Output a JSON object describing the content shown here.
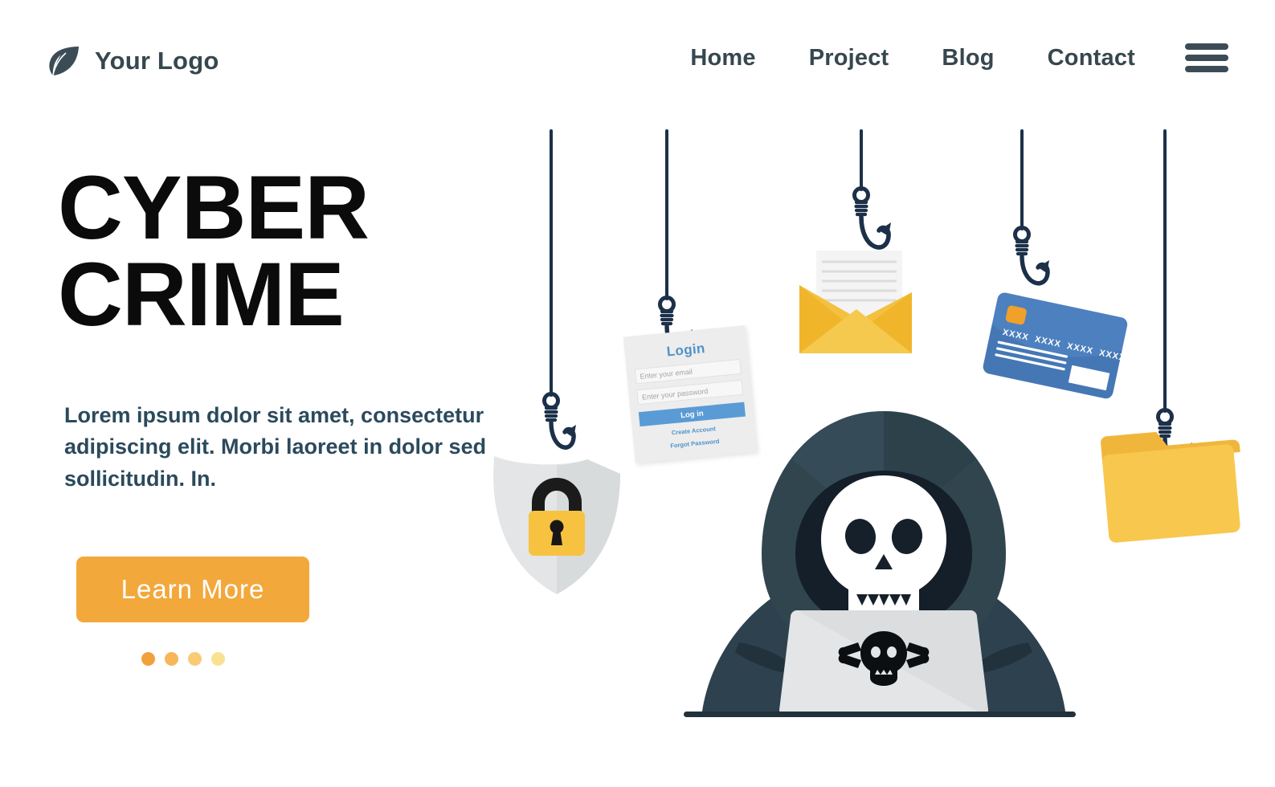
{
  "header": {
    "logo": {
      "text": "Your Logo",
      "icon": "leaf-icon",
      "color": "#36474F"
    },
    "nav_items": [
      {
        "label": "Home"
      },
      {
        "label": "Project"
      },
      {
        "label": "Blog"
      },
      {
        "label": "Contact"
      }
    ],
    "menu_icon": "hamburger-menu-icon"
  },
  "hero": {
    "headline_line1": "CYBER",
    "headline_line2": "CRIME",
    "paragraph": "Lorem ipsum dolor sit amet, consectetur adipiscing elit. Morbi laoreet in dolor sed sollicitudin. In.",
    "cta_label": "Learn  More",
    "carousel_dots": [
      "#F2A03C",
      "#F6B659",
      "#F9CC73",
      "#FAE191"
    ],
    "colors": {
      "headline": "#0B0B0B",
      "paragraph": "#2B4A5C",
      "cta_background": "#F3A83C",
      "cta_text": "#FFFFFF"
    }
  },
  "illustration": {
    "theme": "phishing-hooks-cyber-crime",
    "hook_color": "#1C3049",
    "hooks": [
      {
        "name": "shield-lock-hook",
        "bait": "shield-padlock"
      },
      {
        "name": "login-form-hook",
        "bait": "login-card"
      },
      {
        "name": "email-hook",
        "bait": "envelope-letter"
      },
      {
        "name": "credit-card-hook",
        "bait": "credit-card"
      },
      {
        "name": "folder-hook",
        "bait": "file-folder"
      }
    ],
    "login_card": {
      "title": "Login",
      "email_placeholder": "Enter your email",
      "password_placeholder": "Enter your password",
      "submit_label": "Log in",
      "create_account_label": "Create Account",
      "forgot_password_label": "Forgot Password",
      "accent_color": "#5A9BD5"
    },
    "credit_card": {
      "number": "XXXX  XXXX  XXXX  XXXX",
      "card_color": "#4D80BF",
      "chip_color": "#F0A02B"
    },
    "shield": {
      "color": "#E3E5E6",
      "padlock_color": "#F7C23F"
    },
    "envelope": {
      "color": "#F3C13F",
      "letter_color": "#F2F2F2"
    },
    "folder": {
      "color": "#F8C74E"
    },
    "hacker": {
      "name": "hooded-hacker-with-laptop",
      "hood_color": "#2E414E",
      "skull_color": "#FFFFFF",
      "laptop_color": "#E3E5E7",
      "laptop_logo": "skull-and-crossbones-icon"
    }
  }
}
